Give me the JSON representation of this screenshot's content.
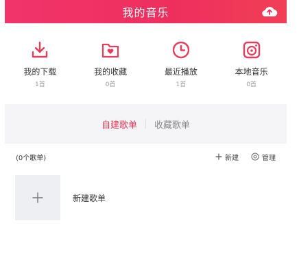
{
  "header": {
    "title": "我的音乐",
    "upload_icon": "cloud-upload-icon"
  },
  "stats": [
    {
      "label": "我的下载",
      "count": "1首",
      "icon": "download-icon"
    },
    {
      "label": "我的收藏",
      "count": "0首",
      "icon": "favorite-folder-icon"
    },
    {
      "label": "最近播放",
      "count": "1首",
      "icon": "clock-icon"
    },
    {
      "label": "本地音乐",
      "count": "0首",
      "icon": "local-music-icon"
    }
  ],
  "tabs": {
    "active": "自建歌单",
    "inactive": "收藏歌单"
  },
  "toolbar": {
    "count_text": "(0个歌单)",
    "new_label": "新建",
    "manage_label": "管理"
  },
  "new_playlist": {
    "label": "新建歌单"
  },
  "colors": {
    "accent": "#ec3a5b",
    "header_bg": "#f1346a",
    "gap_bg": "#f5f5f7",
    "tile_bg": "#eeeff3"
  }
}
